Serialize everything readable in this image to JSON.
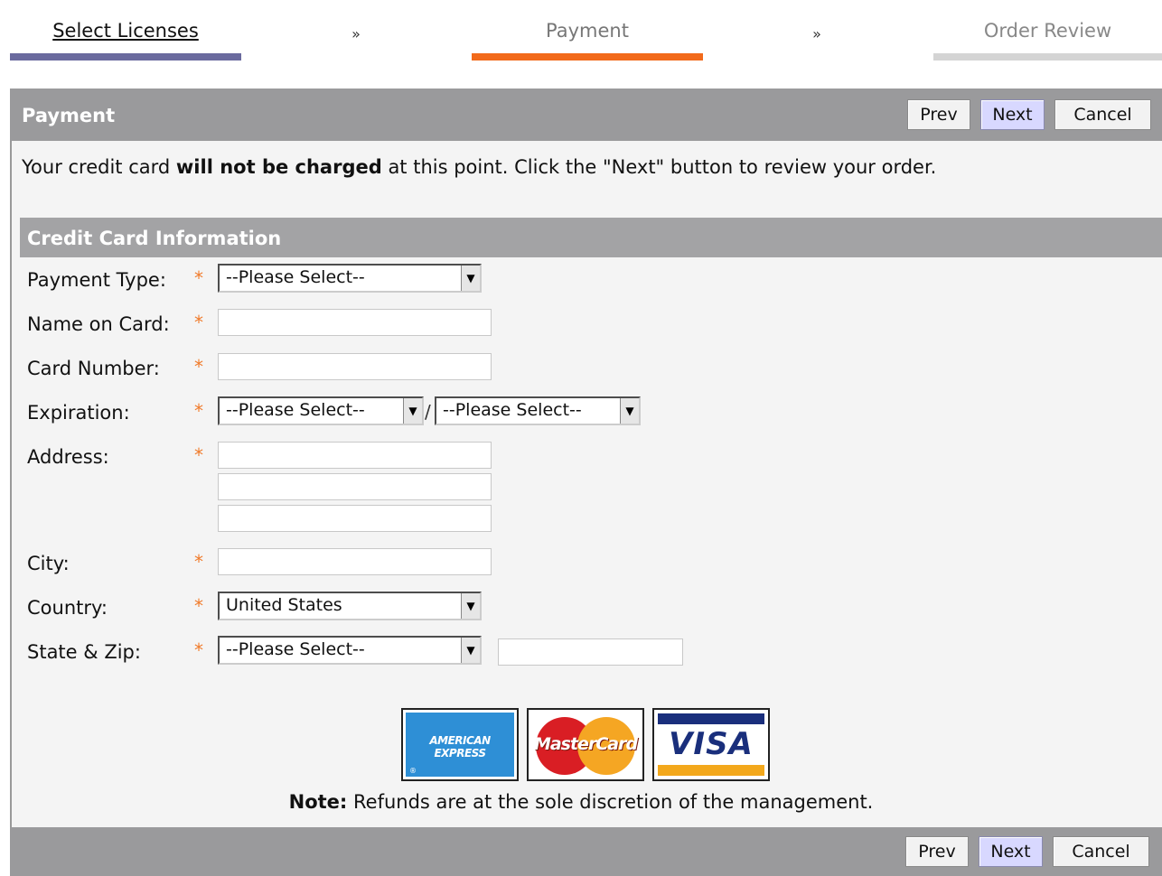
{
  "steps": {
    "step1": "Select Licenses",
    "step2": "Payment",
    "step3": "Order Review",
    "separator": "»"
  },
  "header": {
    "title": "Payment",
    "prev_label": "Prev",
    "next_label": "Next",
    "cancel_label": "Cancel"
  },
  "intro": {
    "before": "Your credit card ",
    "bold": "will not be charged",
    "after": " at this point. Click the \"Next\" button to review your order."
  },
  "section": {
    "title": "Credit Card Information"
  },
  "form": {
    "required_mark": "*",
    "payment_type": {
      "label": "Payment Type:",
      "value": "--Please Select--"
    },
    "name_on_card": {
      "label": "Name on Card:",
      "value": ""
    },
    "card_number": {
      "label": "Card Number:",
      "value": ""
    },
    "expiration": {
      "label": "Expiration:",
      "month": "--Please Select--",
      "year": "--Please Select--",
      "separator": "/"
    },
    "address": {
      "label": "Address:",
      "line1": "",
      "line2": "",
      "line3": ""
    },
    "city": {
      "label": "City:",
      "value": ""
    },
    "country": {
      "label": "Country:",
      "value": "United States"
    },
    "state_zip": {
      "label": "State & Zip:",
      "state": "--Please Select--",
      "zip": ""
    }
  },
  "cards": {
    "amex_line1": "AMERICAN",
    "amex_line2": "EXPRESS",
    "amex_reg": "®",
    "mastercard": "MasterCard",
    "visa": "VISA"
  },
  "note": {
    "bold": "Note:",
    "text": " Refunds are at the sole discretion of the management."
  },
  "footer": {
    "prev_label": "Prev",
    "next_label": "Next",
    "cancel_label": "Cancel"
  },
  "colors": {
    "step1_bar": "#6a6a9e",
    "step2_bar": "#f26a1b",
    "step3_bar": "#d4d4d4",
    "header_bar": "#9a9a9c",
    "required": "#f07a2a",
    "next_button": "#d8d8ff"
  }
}
